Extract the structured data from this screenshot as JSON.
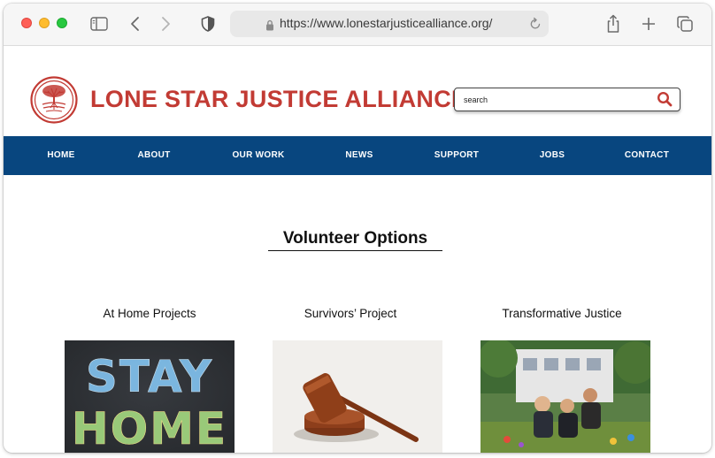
{
  "browser": {
    "url": "https://www.lonestarjusticealliance.org/"
  },
  "site": {
    "title": "LONE STAR JUSTICE ALLIANCE",
    "search_placeholder": "search",
    "brand_red": "#c23b34",
    "nav_blue": "#08467f"
  },
  "nav": {
    "items": [
      {
        "label": "HOME"
      },
      {
        "label": "ABOUT"
      },
      {
        "label": "OUR WORK"
      },
      {
        "label": "NEWS"
      },
      {
        "label": "SUPPORT"
      },
      {
        "label": "JOBS"
      },
      {
        "label": "CONTACT"
      }
    ]
  },
  "main": {
    "heading": "Volunteer Options",
    "cards": [
      {
        "title": "At Home Projects",
        "image_text": [
          "STAY",
          "HOME"
        ]
      },
      {
        "title": "Survivors’ Project"
      },
      {
        "title": "Transformative Justice"
      }
    ]
  }
}
